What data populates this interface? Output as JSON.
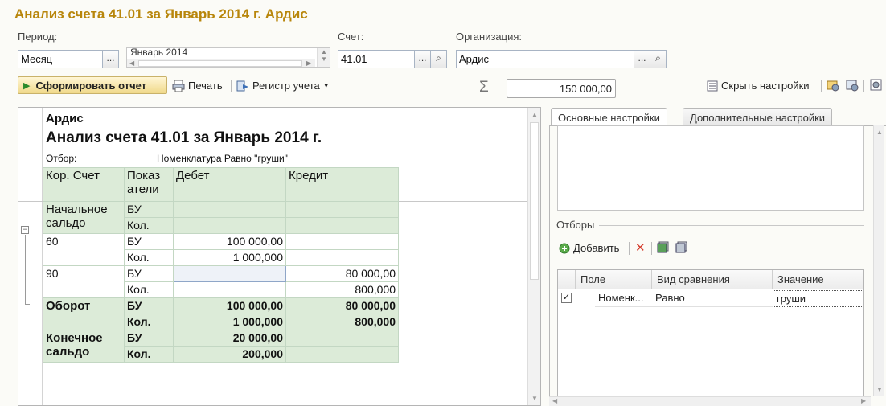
{
  "window": {
    "title": "Анализ счета 41.01 за Январь 2014 г. Ардис"
  },
  "params": {
    "period_label": "Период:",
    "period_type": "Месяц",
    "period_value": "Январь 2014",
    "account_label": "Счет:",
    "account_value": "41.01",
    "org_label": "Организация:",
    "org_value": "Ардис",
    "ellipsis": "...",
    "search_glyph": "⌕"
  },
  "toolbar": {
    "generate_label": "Сформировать отчет",
    "print_label": "Печать",
    "register_label": "Регистр учета",
    "sigma": "Σ",
    "sum_value": "150 000,00",
    "hide_settings_label": "Скрыть настройки"
  },
  "report": {
    "org": "Ардис",
    "title": "Анализ счета 41.01 за Январь 2014 г.",
    "filter_label": "Отбор:",
    "filter_value": "Номенклатура Равно \"груши\"",
    "headers": {
      "corr": "Кор. Счет",
      "ind": "Показ атели",
      "debit": "Дебет",
      "credit": "Кредит"
    },
    "opening": {
      "label": "Начальное сальдо",
      "bu": "БУ",
      "kol": "Кол."
    },
    "rows": [
      {
        "account": "60",
        "bu": "БУ",
        "kol": "Кол.",
        "debit_bu": "100 000,00",
        "debit_kol": "1 000,000",
        "credit_bu": "",
        "credit_kol": ""
      },
      {
        "account": "90",
        "bu": "БУ",
        "kol": "Кол.",
        "debit_bu": "",
        "debit_kol": "",
        "credit_bu": "80 000,00",
        "credit_kol": "800,000"
      }
    ],
    "turnover": {
      "label": "Оборот",
      "bu": "БУ",
      "kol": "Кол.",
      "debit_bu": "100 000,00",
      "debit_kol": "1 000,000",
      "credit_bu": "80 000,00",
      "credit_kol": "800,000"
    },
    "closing": {
      "label": "Конечное сальдо",
      "bu": "БУ",
      "kol": "Кол.",
      "debit_bu": "20 000,00",
      "debit_kol": "200,000"
    }
  },
  "settings": {
    "tabs": [
      "Основные настройки",
      "Дополнительные настройки"
    ],
    "filters_label": "Отборы",
    "add_label": "Добавить",
    "columns": [
      "Поле",
      "Вид сравнения",
      "Значение"
    ],
    "filter_rows": [
      {
        "checked": true,
        "field": "Номенк...",
        "comparison": "Равно",
        "value": "груши"
      }
    ]
  },
  "colors": {
    "title": "#b8860b",
    "report_header_bg": "#dcebd8",
    "generate_button": "#f0d98a"
  }
}
